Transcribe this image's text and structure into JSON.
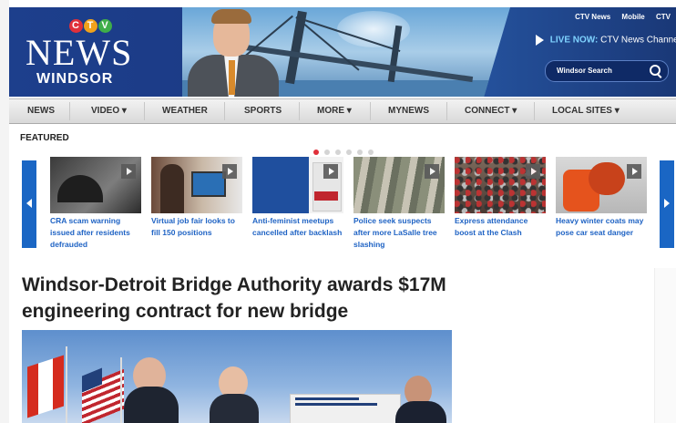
{
  "header": {
    "logo": {
      "network": "CTV",
      "network_letters": [
        "C",
        "T",
        "V"
      ],
      "brand": "NEWS",
      "city": "WINDSOR"
    },
    "top_links": [
      "CTV News",
      "Mobile",
      "CTV"
    ],
    "live": {
      "label": "LIVE NOW:",
      "channel": "CTV News Channel"
    },
    "search": {
      "placeholder": "Windsor Search"
    }
  },
  "nav": {
    "items": [
      {
        "label": "NEWS"
      },
      {
        "label": "VIDEO ▾"
      },
      {
        "label": "WEATHER"
      },
      {
        "label": "SPORTS"
      },
      {
        "label": "MORE ▾"
      },
      {
        "label": "MYNEWS"
      },
      {
        "label": "CONNECT ▾"
      },
      {
        "label": "LOCAL SITES ▾"
      }
    ]
  },
  "featured": {
    "label": "FEATURED",
    "dots": 6,
    "active_dot": 0,
    "cards": [
      {
        "title": "CRA scam warning issued after residents defrauded",
        "icon": "video-play-icon"
      },
      {
        "title": "Virtual job fair looks to fill 150 positions",
        "icon": "video-play-icon"
      },
      {
        "title": "Anti-feminist meetups cancelled after backlash",
        "icon": "video-play-icon"
      },
      {
        "title": "Police seek suspects after more LaSalle tree slashing",
        "icon": "video-play-icon"
      },
      {
        "title": "Express attendance boost at the Clash",
        "icon": "video-play-icon"
      },
      {
        "title": "Heavy winter coats may pose car seat danger",
        "icon": "video-play-icon"
      }
    ]
  },
  "article": {
    "headline": "Windsor-Detroit Bridge Authority awards $17M engineering contract for new bridge"
  },
  "colors": {
    "header_blue": "#1d3f8c",
    "link_blue": "#1f63c4",
    "arrow_blue": "#1a66c4",
    "active_dot_red": "#e0303a"
  }
}
